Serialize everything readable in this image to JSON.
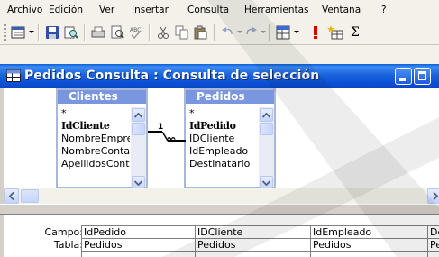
{
  "menu": {
    "items": [
      {
        "first": "A",
        "rest": "rchivo"
      },
      {
        "first": "E",
        "rest": "dición"
      },
      {
        "first": "V",
        "rest": "er"
      },
      {
        "first": "I",
        "rest": "nsertar"
      },
      {
        "first": "C",
        "rest": "onsulta"
      },
      {
        "first": "H",
        "rest": "erramientas"
      },
      {
        "first": "Ve",
        "rest": "ntana"
      },
      {
        "first": "?",
        "rest": ""
      }
    ]
  },
  "toolbar": {
    "icons": [
      "view-icon",
      "save-icon",
      "search-icon",
      "print-icon",
      "print-preview-icon",
      "spelling-icon",
      "cut-icon",
      "copy-icon",
      "paste-icon",
      "undo-icon",
      "redo-icon",
      "query-type-icon",
      "run-icon",
      "show-table-icon",
      "totals-icon"
    ],
    "sigma": "Σ"
  },
  "window": {
    "title": "Pedidos Consulta : Consulta de selección"
  },
  "tables": [
    {
      "name": "Clientes",
      "fields": [
        "*",
        "IdCliente",
        "NombreEmpre",
        "NombreConta",
        "ApellidosCont"
      ]
    },
    {
      "name": "Pedidos",
      "fields": [
        "*",
        "IdPedido",
        "IDCliente",
        "IdEmpleado",
        "Destinatario"
      ]
    }
  ],
  "relationship": {
    "one": "1",
    "many": "∞"
  },
  "grid": {
    "row_labels": [
      "Campo:",
      "Tabla:"
    ],
    "columns": [
      {
        "campo": "IdPedido",
        "tabla": "Pedidos"
      },
      {
        "campo": "IDCliente",
        "tabla": "Pedidos"
      },
      {
        "campo": "IdEmpleado",
        "tabla": "Pedidos"
      },
      {
        "campo": "De",
        "tabla": "Pe"
      }
    ]
  },
  "colors": {
    "title_bar": "#0b4fd3",
    "table_header": "#7a96df",
    "watermark": "#e4e4e4"
  }
}
